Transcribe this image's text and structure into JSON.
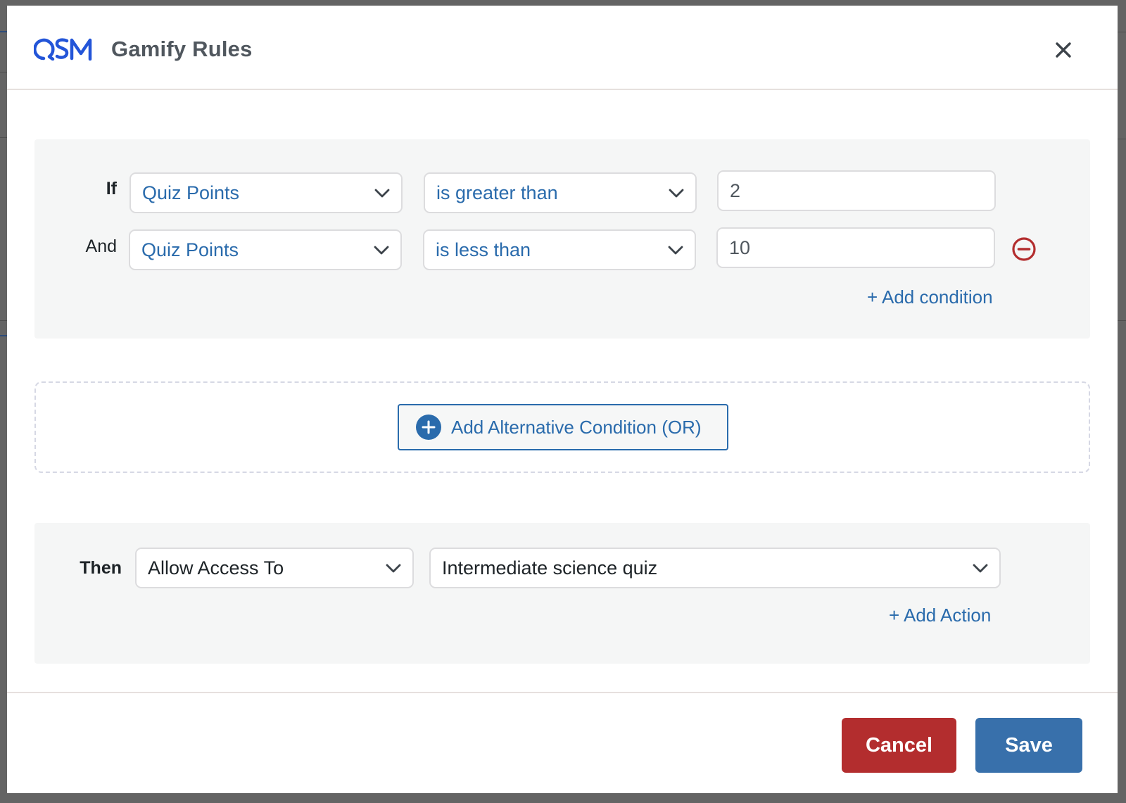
{
  "modal": {
    "logo_text": "QSM",
    "title": "Gamify Rules",
    "close_label": "Close"
  },
  "conditions": {
    "rows": [
      {
        "connector": "If",
        "field": "Quiz Points",
        "operator": "is greater than",
        "value": "2",
        "removable": false
      },
      {
        "connector": "And",
        "field": "Quiz Points",
        "operator": "is less than",
        "value": "10",
        "removable": true
      }
    ],
    "add_condition_label": "+ Add condition"
  },
  "alternative": {
    "add_label": "Add Alternative Condition (OR)"
  },
  "actions": {
    "label": "Then",
    "action": "Allow Access To",
    "target": "Intermediate science quiz",
    "add_action_label": "+ Add Action"
  },
  "footer": {
    "cancel_label": "Cancel",
    "save_label": "Save"
  },
  "colors": {
    "brand_blue": "#2355d8",
    "link_blue": "#2a6bac",
    "danger_red": "#b32d2e",
    "save_blue": "#3870ab",
    "panel_bg": "#f5f6f6"
  }
}
